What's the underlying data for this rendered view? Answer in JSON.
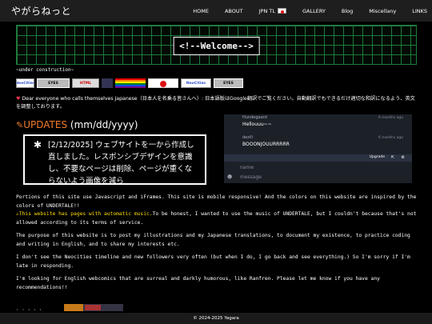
{
  "nav": {
    "logo": "やがらねっと",
    "links": [
      "HOME",
      "ABOUT",
      "JPN TL",
      "GALLERY",
      "Blog",
      "Miscellany",
      "LINKS"
    ]
  },
  "banner": {
    "title": "<!--Welcome-->"
  },
  "under_construction": "~under construction~",
  "buttons": {
    "neocities_1": "NeoCities",
    "eyes_1": "EYES",
    "html": "HTML",
    "neocities_2": "NeoCities",
    "eyes_2": "EYES"
  },
  "notice": {
    "heart": "♥",
    "text": "Dear everyone who calls themselves Japanese（日本人を名乗る皆さんへ）: 日本語版はGoogle翻訳でご覧ください。自動翻訳でもできるだけ適切な和訳になるよう、英文を調整しております。"
  },
  "updates": {
    "title": "UPDATES",
    "date_format": "(mm/dd/yyyy)",
    "bullet": "✱",
    "items": [
      "[2/12/2025] ウェブサイトを一から作成し直しました。レスポンシブデザインを意識し、不要なページは削除、ページが重くならないよう画像を減ら"
    ]
  },
  "chat": {
    "messages": [
      {
        "name": "Hundegaard",
        "text": "Hellouuu~~",
        "time": "6 months ago"
      },
      {
        "name": "dezili",
        "text": "BOOONJOUURRRRR",
        "time": "6 months ago"
      }
    ],
    "upgrade": "Upgrade",
    "name_placeholder": "name",
    "message_placeholder": "message"
  },
  "paragraphs": {
    "p1": "Portions of this site use Javascript and iFrames. This site is mobile responsive! And the colors on this website are inspired by the colors of UNDERTALE!!",
    "p1_warn": "⚠This website has pages with automatic music.",
    "p1_rest": "To be honest, I wanted to use the music of UNDERTALE, but I couldn't because that's not allowed according to its terms of service.",
    "p2": "The purpose of this website is to post my illustrations and my Japanese translations, to document my existence, to practice coding and writing in English, and to share my interests etc.",
    "p3": "I don't see the Neocities timeline and new followers very often (but when I do, I go back and see everything.) So I'm sorry if I'm late in responding.",
    "p4": "I'm looking for English webcomics that are surreal and darkly humorous, like Ranfren. Please let me know if you have any recommendations!!"
  },
  "footer": "© 2024-2025 Yagara",
  "colors": {
    "background": "#000000",
    "nav_bg": "#1e1e1e",
    "grid_green": "#1f7a3d",
    "updates_orange": "#f07b2c",
    "warning_yellow": "#ffdf00",
    "heart_red": "#e2344b",
    "chat_bg": "#1c2128"
  },
  "icons": {
    "pencil": "pencil-icon",
    "heart": "heart-icon",
    "warning": "warning-icon",
    "jp_flag": "japan-flag-icon"
  }
}
